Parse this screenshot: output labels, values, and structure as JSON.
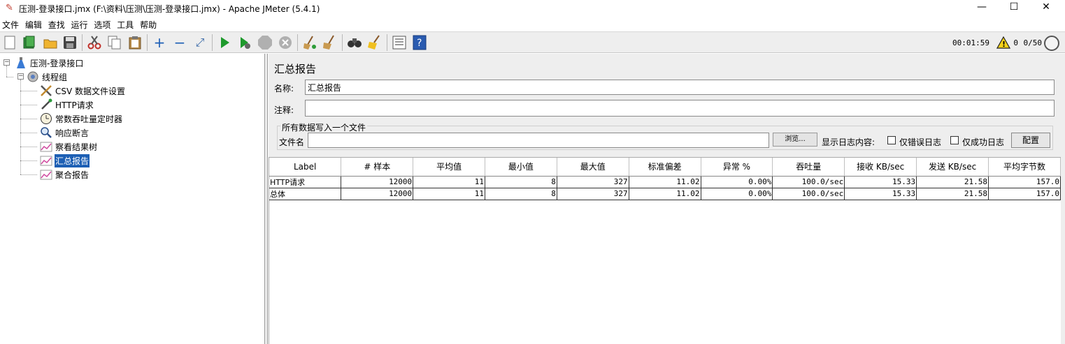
{
  "window": {
    "title": "压测-登录接口.jmx (F:\\资料\\压测\\压测-登录接口.jmx) - Apache JMeter (5.4.1)",
    "minimize_glyph": "—",
    "maximize_glyph": "☐",
    "close_glyph": "✕"
  },
  "menu": [
    "文件",
    "编辑",
    "查找",
    "运行",
    "选项",
    "工具",
    "帮助"
  ],
  "toolbar": {
    "timer": "00:01:59",
    "error_count": "0",
    "threads": "0/50",
    "buttons": [
      "new-icon",
      "templates-icon",
      "open-icon",
      "save-icon",
      "cut-icon",
      "copy-icon",
      "paste-icon",
      "expand-icon",
      "collapse-icon",
      "toggle-icon",
      "start-icon",
      "start-no-pause-icon",
      "stop-icon",
      "shutdown-icon",
      "clear-icon",
      "clear-all-icon",
      "search-icon",
      "reset-search-icon",
      "function-helper-icon",
      "help-icon"
    ]
  },
  "tree": {
    "root": "压测-登录接口",
    "thread_group": "线程组",
    "children": [
      {
        "label": "CSV 数据文件设置",
        "icon": "wrench-icon"
      },
      {
        "label": "HTTP请求",
        "icon": "pipette-icon"
      },
      {
        "label": "常数吞吐量定时器",
        "icon": "clock-icon"
      },
      {
        "label": "响应断言",
        "icon": "magnifier-icon"
      },
      {
        "label": "察看结果树",
        "icon": "chart-icon"
      },
      {
        "label": "汇总报告",
        "icon": "chart-icon"
      },
      {
        "label": "聚合报告",
        "icon": "chart-icon"
      }
    ],
    "selected": "汇总报告"
  },
  "panel": {
    "title": "汇总报告",
    "name_label": "名称:",
    "name_value": "汇总报告",
    "comment_label": "注释:",
    "comment_value": "",
    "group_title": "所有数据写入一个文件",
    "filename_label": "文件名",
    "filename_value": "",
    "browse_label": "浏览...",
    "log_content_label": "显示日志内容:",
    "errors_only_label": "仅错误日志",
    "success_only_label": "仅成功日志",
    "configure_label": "配置"
  },
  "table": {
    "headers": [
      "Label",
      "# 样本",
      "平均值",
      "最小值",
      "最大值",
      "标准偏差",
      "异常 %",
      "吞吐量",
      "接收 KB/sec",
      "发送 KB/sec",
      "平均字节数"
    ],
    "rows": [
      [
        "HTTP请求",
        "12000",
        "11",
        "8",
        "327",
        "11.02",
        "0.00%",
        "100.0/sec",
        "15.33",
        "21.58",
        "157.0"
      ],
      [
        "总体",
        "12000",
        "11",
        "8",
        "327",
        "11.02",
        "0.00%",
        "100.0/sec",
        "15.33",
        "21.58",
        "157.0"
      ]
    ]
  }
}
